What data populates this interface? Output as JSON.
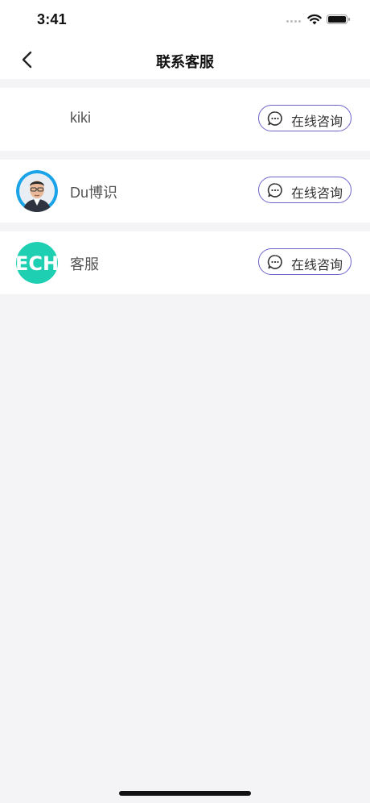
{
  "status": {
    "time": "3:41"
  },
  "nav": {
    "title": "联系客服"
  },
  "contacts": [
    {
      "name": "kiki",
      "button_label": "在线咨询"
    },
    {
      "name": "Du博识",
      "button_label": "在线咨询"
    },
    {
      "name": "客服",
      "button_label": "在线咨询",
      "avatar_text": "ECH"
    }
  ],
  "colors": {
    "accent": "#6c63c9",
    "background": "#f4f4f6",
    "avatar_ech": "#1ecfb1",
    "avatar_photo_bg": "#1aa3e8"
  }
}
